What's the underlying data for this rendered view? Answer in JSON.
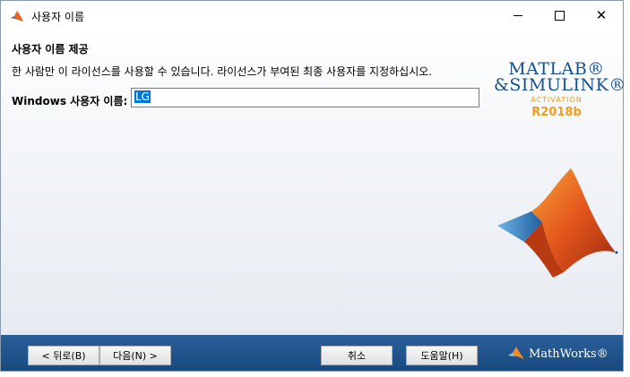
{
  "window": {
    "title": "사용자 이름",
    "controls": {
      "minimize": "",
      "maximize": "",
      "close": "✕"
    }
  },
  "main": {
    "heading": "사용자 이름 제공",
    "description": "한 사람만 이 라이선스를 사용할 수 있습니다. 라이선스가 부여된 최종 사용자를 지정하십시오.",
    "username_label": "Windows 사용자 이름:",
    "username_value": "LG"
  },
  "logo": {
    "line1": "MATLAB®",
    "line2": "&SIMULINK®",
    "subtitle": "ACTIVATION",
    "release": "R2018b"
  },
  "footer": {
    "back_label": "< 뒤로(B)",
    "next_label": "다음(N) >",
    "cancel_label": "취소",
    "help_label": "도움말(H)",
    "brand": "MathWorks®"
  },
  "colors": {
    "accent_blue": "#174f8f",
    "accent_orange": "#f09c1f",
    "footer_blue": "#1f558c",
    "selection": "#0078d7"
  },
  "icons": [
    "matlab-membrane-icon",
    "minimize-icon",
    "maximize-icon",
    "close-icon",
    "mathworks-logo-icon"
  ]
}
